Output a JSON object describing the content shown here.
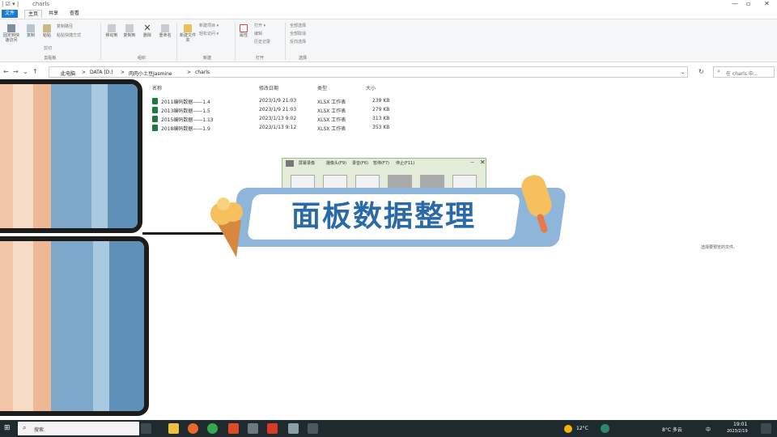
{
  "window": {
    "title": "charls",
    "quick_access": "| ☑ ▾ |",
    "min": "—",
    "max": "▫",
    "close": "✕"
  },
  "tabs": [
    "文件",
    "主页",
    "共享",
    "查看"
  ],
  "ribbon": {
    "pin_label": "固定到快速访问",
    "copy_label": "复制",
    "paste_label": "粘贴",
    "copy_path": "复制路径",
    "paste_shortcut": "粘贴快捷方式",
    "cut": "剪切",
    "move_to": "移动到",
    "copy_to": "复制到",
    "delete": "删除",
    "rename": "重命名",
    "new_folder": "新建文件夹",
    "new_item": "新建项目 ▾",
    "easy_access": "轻松访问 ▾",
    "properties": "属性",
    "open": "打开 ▾",
    "edit": "编辑",
    "history": "历史记录",
    "select_all": "全部选择",
    "select_none": "全部取消",
    "invert": "反向选择",
    "groups": [
      "剪贴板",
      "组织",
      "新建",
      "打开",
      "选择"
    ]
  },
  "address": {
    "back": "←",
    "forward": "→",
    "recent": "⌄",
    "up": "↑",
    "crumbs": [
      "此电脑",
      ">",
      "DATA (D:)",
      ">",
      "肉肉小土豆Jasmine",
      ">",
      "charls"
    ],
    "dropdown": "⌄",
    "refresh": "↻",
    "search_placeholder": "在 charls 中..."
  },
  "columns": [
    "名称",
    "修改日期",
    "类型",
    "大小"
  ],
  "files": [
    {
      "name": "2011编码数据——1.4",
      "date": "2023/1/9 21:03",
      "type": "XLSX 工作表",
      "size": "239 KB"
    },
    {
      "name": "2013编码数据——1.5",
      "date": "2023/1/9 21:03",
      "type": "XLSX 工作表",
      "size": "279 KB"
    },
    {
      "name": "2015编码数据——1.13",
      "date": "2023/1/13 9:02",
      "type": "XLSX 工作表",
      "size": "313 KB"
    },
    {
      "name": "2018编码数据——1.9",
      "date": "2023/1/13 9:12",
      "type": "XLSX 工作表",
      "size": "353 KB"
    }
  ],
  "preview_hint": "选择要预览的文件。",
  "banner": {
    "title": "面板数据整理"
  },
  "recorder": {
    "title": "屏幕录像",
    "menu": [
      "摄像头(F9)",
      "录音(F6)",
      "暂停(F7)",
      "停止(F11)"
    ],
    "min": "—",
    "close": "✕"
  },
  "taskbar": {
    "search_label": "搜索",
    "weather1": "12°C",
    "weather2": "8°C 多云",
    "ime": "中",
    "time": "19:01",
    "date": "2023/2/19"
  },
  "colors": {
    "accent": "#1a7bd0",
    "banner": "#8fb6da",
    "banner_text": "#2a6aa8",
    "taskbar": "#1f2a2e"
  }
}
